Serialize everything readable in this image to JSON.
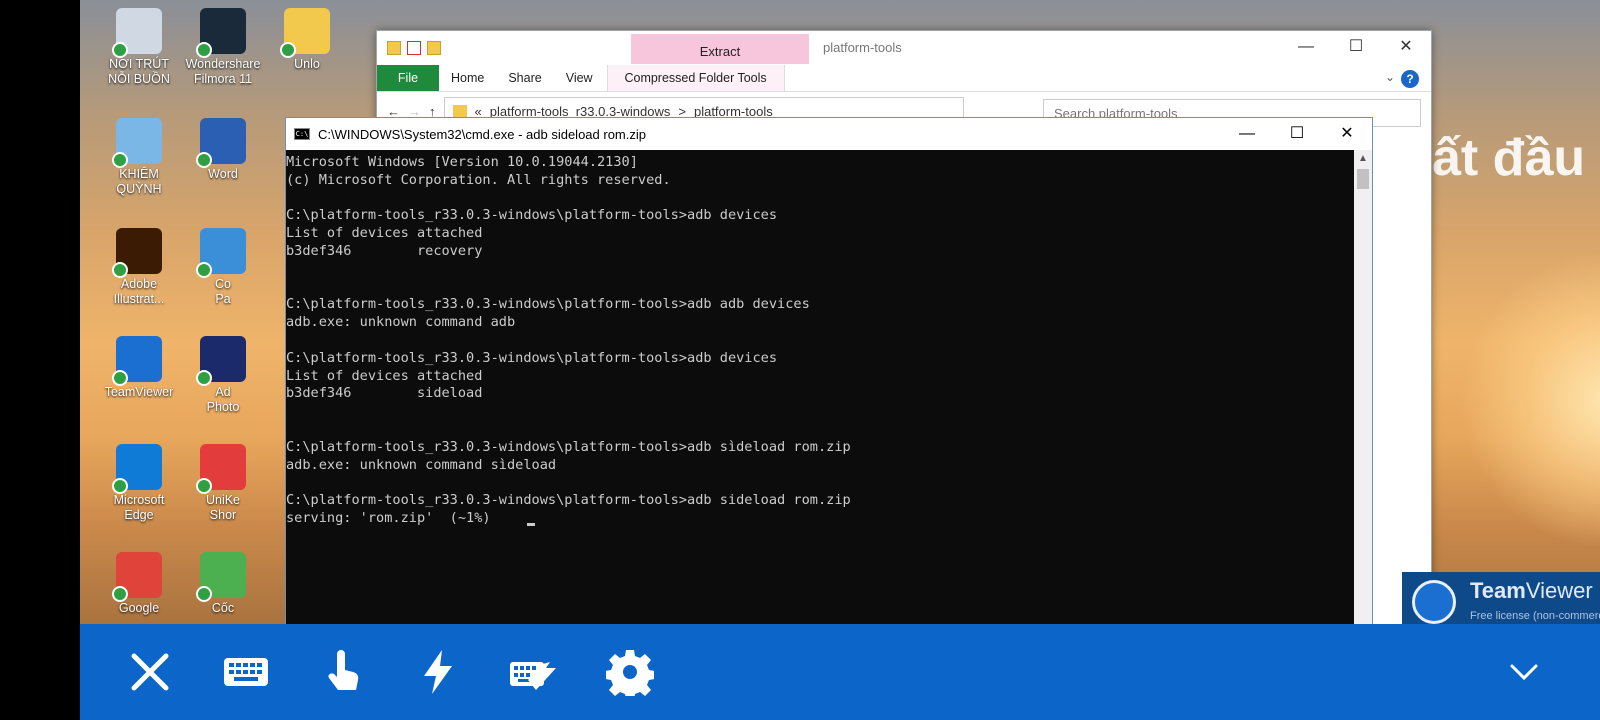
{
  "desktop": {
    "wallpaper_text": "ất đầu",
    "icons": [
      {
        "id": "recycle",
        "label": "NƠI TRÚT\nNỖI BUỒN",
        "color": "#cfd8e3"
      },
      {
        "id": "filmora",
        "label": "Wondershare\nFilmora 11",
        "color": "#1a2a3a"
      },
      {
        "id": "unlock",
        "label": "Unlo",
        "color": "#f2c94c"
      },
      {
        "id": "pc",
        "label": "KHIÊM\nQUỲNH",
        "color": "#7ab6e6"
      },
      {
        "id": "word",
        "label": "Word",
        "color": "#2b5fb3"
      },
      {
        "id": "illustrator",
        "label": "Adobe\nIllustrat...",
        "color": "#3b1b04"
      },
      {
        "id": "control",
        "label": "Co\nPa",
        "color": "#3a8fd8"
      },
      {
        "id": "teamviewer",
        "label": "TeamViewer",
        "color": "#1b6fd0"
      },
      {
        "id": "photoshop",
        "label": "Ad\nPhoto",
        "color": "#1b2a6a"
      },
      {
        "id": "edge",
        "label": "Microsoft\nEdge",
        "color": "#0f7bd6"
      },
      {
        "id": "unikey",
        "label": "UniKe\nShor",
        "color": "#e23c3c"
      },
      {
        "id": "chrome",
        "label": "Google",
        "color": "#e0433a"
      },
      {
        "id": "coc",
        "label": "Cốc",
        "color": "#4caf50"
      }
    ]
  },
  "explorer": {
    "extract_tab": "Extract",
    "title": "platform-tools",
    "ribbon": {
      "file": "File",
      "home": "Home",
      "share": "Share",
      "view": "View",
      "compressed": "Compressed Folder Tools",
      "help": "?"
    },
    "address": {
      "crumb1": "platform-tools_r33.0.3-windows",
      "sep": ">",
      "crumb2": "platform-tools",
      "back": "«"
    },
    "search_placeholder": "Search platform-tools",
    "controls": {
      "minimize": "—",
      "maximize": "☐",
      "close": "✕"
    }
  },
  "cmd": {
    "title": "C:\\WINDOWS\\System32\\cmd.exe - adb  sideload rom.zip",
    "controls": {
      "minimize": "—",
      "maximize": "☐",
      "close": "✕"
    },
    "lines": [
      "Microsoft Windows [Version 10.0.19044.2130]",
      "(c) Microsoft Corporation. All rights reserved.",
      "",
      "C:\\platform-tools_r33.0.3-windows\\platform-tools>adb devices",
      "List of devices attached",
      "b3def346        recovery",
      "",
      "",
      "C:\\platform-tools_r33.0.3-windows\\platform-tools>adb adb devices",
      "adb.exe: unknown command adb",
      "",
      "C:\\platform-tools_r33.0.3-windows\\platform-tools>adb devices",
      "List of devices attached",
      "b3def346        sideload",
      "",
      "",
      "C:\\platform-tools_r33.0.3-windows\\platform-tools>adb sìdeload rom.zip",
      "adb.exe: unknown command sìdeload",
      "",
      "C:\\platform-tools_r33.0.3-windows\\platform-tools>adb sideload rom.zip",
      "serving: 'rom.zip'  (~1%)"
    ]
  },
  "teamviewer_notice": {
    "brand_bold": "Team",
    "brand_light": "Viewer",
    "subtitle": "Free license (non-commercial",
    "close": "✕"
  },
  "toolbar": {
    "buttons": [
      {
        "id": "close",
        "icon": "close-icon"
      },
      {
        "id": "keyboard",
        "icon": "keyboard-icon"
      },
      {
        "id": "touch",
        "icon": "touch-icon"
      },
      {
        "id": "actions",
        "icon": "lightning-icon"
      },
      {
        "id": "special-keys",
        "icon": "keyboard-arrow-icon"
      },
      {
        "id": "settings",
        "icon": "gear-icon"
      }
    ],
    "collapse_icon": "chevron-down-icon",
    "color": "#0c66c9"
  }
}
